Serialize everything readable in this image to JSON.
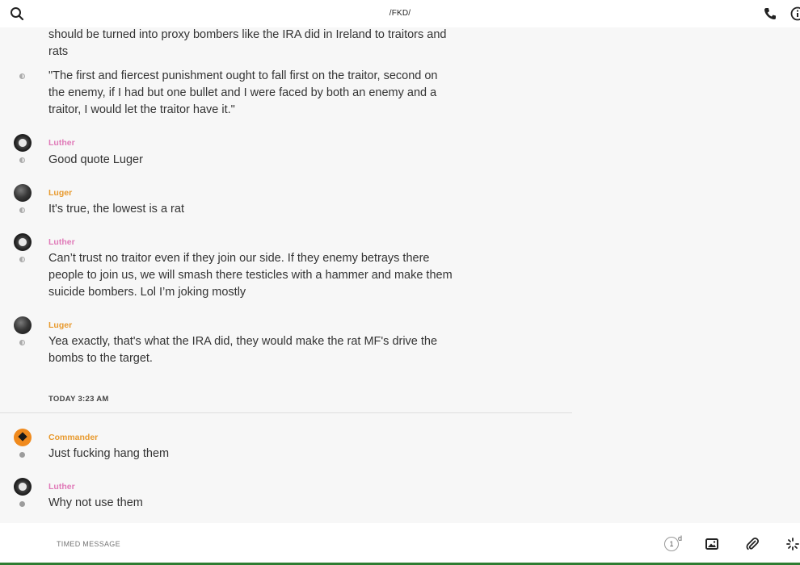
{
  "header": {
    "title": "/FKD/",
    "icons": {
      "left": "search-icon",
      "call": "phone-icon",
      "info": "info-icon"
    }
  },
  "messages": [
    {
      "sender": "",
      "avatar": "",
      "status": "sent",
      "text": "should be turned into proxy bombers like the IRA did in Ireland to traitors and rats"
    },
    {
      "sender": "",
      "avatar": "",
      "status": "sent",
      "text": "\"The  first and fiercest punishment ought to fall first on the traitor, second on the enemy, if I had but one bullet and I were faced by both an enemy and a traitor, I would let the traitor have it.\""
    },
    {
      "sender": "Luther",
      "avatar": "luther",
      "status": "sent",
      "text": "Good quote Luger"
    },
    {
      "sender": "Luger",
      "avatar": "luger",
      "status": "sent",
      "text": "It's true, the lowest is a rat"
    },
    {
      "sender": "Luther",
      "avatar": "luther",
      "status": "sent",
      "text": "Can’t trust no traitor even if they join our side. If they enemy betrays there people to join us, we will smash there testicles with a hammer and make them suicide bombers. Lol I’m joking mostly"
    },
    {
      "sender": "Luger",
      "avatar": "luger",
      "status": "sent",
      "text": "Yea exactly, that's what the IRA did, they would make the rat MF's drive the bombs to the target."
    },
    {
      "sender": "Commander",
      "avatar": "commander",
      "status": "delivered",
      "text": "Just fucking hang them"
    },
    {
      "sender": "Luther",
      "avatar": "luther",
      "status": "delivered",
      "text": "Why not use them"
    }
  ],
  "divider": {
    "label": "TODAY 3:23 AM"
  },
  "composer": {
    "placeholder": "TIMED MESSAGE",
    "timer_value": "1",
    "timer_unit": "d",
    "icons": [
      "timer-icon",
      "image-icon",
      "attachment-icon",
      "loading-icon"
    ]
  },
  "colors": {
    "luther": "#e07ab8",
    "luger": "#e89a2e",
    "commander": "#e89a2e"
  }
}
